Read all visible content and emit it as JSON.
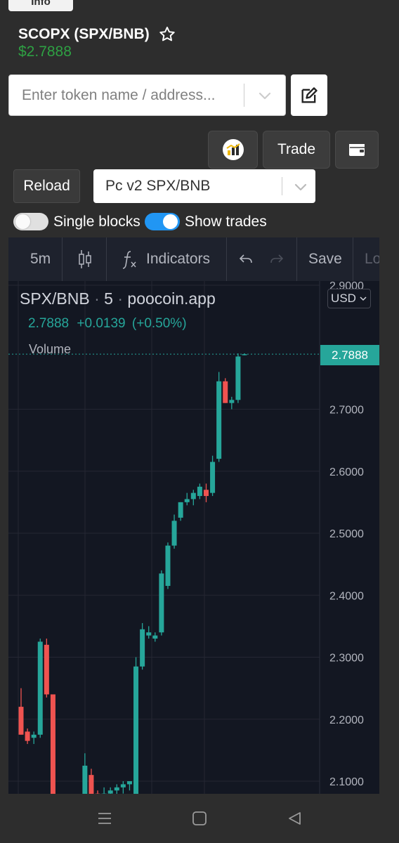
{
  "header": {
    "info_tab": "Info",
    "title": "SCOPX (SPX/BNB)",
    "price": "$2.7888"
  },
  "search": {
    "placeholder": "Enter token name / address..."
  },
  "toolbar": {
    "trade_label": "Trade"
  },
  "controls": {
    "reload_label": "Reload",
    "pair_select_value": "Pc v2 SPX/BNB",
    "single_blocks_label": "Single blocks",
    "single_blocks_on": false,
    "show_trades_label": "Show trades",
    "show_trades_on": true
  },
  "chart_toolbar": {
    "interval": "5m",
    "indicators_label": "Indicators",
    "save_label": "Save",
    "cut_label": "Lo"
  },
  "chart_legend": {
    "symbol": "SPX/BNB",
    "interval": "5",
    "source": "poocoin.app",
    "last": "2.7888",
    "change": "+0.0139",
    "change_pct": "(+0.50%)",
    "volume_label": "Volume",
    "currency": "USD"
  },
  "colors": {
    "up": "#26a69a",
    "down": "#ef5350",
    "price_green": "#2ea043",
    "toggle_on": "#2196f3"
  },
  "chart_data": {
    "type": "candlestick",
    "symbol": "SPX/BNB",
    "interval": "5",
    "ylim": [
      2.07,
      2.905
    ],
    "y_ticks": [
      "2.9000",
      "2.7000",
      "2.6000",
      "2.5000",
      "2.4000",
      "2.3000",
      "2.2000",
      "2.1000"
    ],
    "last_price_label": "2.7888",
    "candles": [
      {
        "o": 2.22,
        "h": 2.25,
        "l": 2.175,
        "c": 2.175
      },
      {
        "o": 2.18,
        "h": 2.185,
        "l": 2.16,
        "c": 2.165
      },
      {
        "o": 2.17,
        "h": 2.18,
        "l": 2.16,
        "c": 2.175
      },
      {
        "o": 2.175,
        "h": 2.33,
        "l": 2.17,
        "c": 2.325
      },
      {
        "o": 2.32,
        "h": 2.33,
        "l": 2.235,
        "c": 2.24
      },
      {
        "o": 2.24,
        "h": 2.24,
        "l": 2.04,
        "c": 2.05
      },
      {
        "o": 2.05,
        "h": 2.05,
        "l": 2.03,
        "c": 2.035
      },
      {
        "o": 2.035,
        "h": 2.045,
        "l": 2.03,
        "c": 2.04
      },
      {
        "o": 2.045,
        "h": 2.05,
        "l": 2.035,
        "c": 2.04
      },
      {
        "o": 2.04,
        "h": 2.06,
        "l": 2.035,
        "c": 2.055
      },
      {
        "o": 2.055,
        "h": 2.145,
        "l": 2.05,
        "c": 2.125
      },
      {
        "o": 2.11,
        "h": 2.12,
        "l": 2.07,
        "c": 2.075
      },
      {
        "o": 2.08,
        "h": 2.085,
        "l": 2.07,
        "c": 2.075
      },
      {
        "o": 2.08,
        "h": 2.09,
        "l": 2.07,
        "c": 2.08
      },
      {
        "o": 2.08,
        "h": 2.09,
        "l": 2.07,
        "c": 2.085
      },
      {
        "o": 2.085,
        "h": 2.095,
        "l": 2.075,
        "c": 2.09
      },
      {
        "o": 2.09,
        "h": 2.1,
        "l": 2.08,
        "c": 2.095
      },
      {
        "o": 2.095,
        "h": 2.1,
        "l": 2.085,
        "c": 2.1
      },
      {
        "o": 2.07,
        "h": 2.3,
        "l": 2.06,
        "c": 2.285
      },
      {
        "o": 2.285,
        "h": 2.355,
        "l": 2.28,
        "c": 2.345
      },
      {
        "o": 2.335,
        "h": 2.35,
        "l": 2.33,
        "c": 2.34
      },
      {
        "o": 2.33,
        "h": 2.34,
        "l": 2.325,
        "c": 2.335
      },
      {
        "o": 2.34,
        "h": 2.44,
        "l": 2.335,
        "c": 2.435
      },
      {
        "o": 2.415,
        "h": 2.485,
        "l": 2.41,
        "c": 2.48
      },
      {
        "o": 2.48,
        "h": 2.53,
        "l": 2.475,
        "c": 2.52
      },
      {
        "o": 2.525,
        "h": 2.55,
        "l": 2.52,
        "c": 2.55
      },
      {
        "o": 2.55,
        "h": 2.565,
        "l": 2.545,
        "c": 2.555
      },
      {
        "o": 2.555,
        "h": 2.57,
        "l": 2.545,
        "c": 2.565
      },
      {
        "o": 2.56,
        "h": 2.58,
        "l": 2.555,
        "c": 2.575
      },
      {
        "o": 2.57,
        "h": 2.58,
        "l": 2.55,
        "c": 2.56
      },
      {
        "o": 2.565,
        "h": 2.625,
        "l": 2.56,
        "c": 2.615
      },
      {
        "o": 2.62,
        "h": 2.76,
        "l": 2.615,
        "c": 2.745
      },
      {
        "o": 2.745,
        "h": 2.75,
        "l": 2.71,
        "c": 2.71
      },
      {
        "o": 2.71,
        "h": 2.72,
        "l": 2.7,
        "c": 2.715
      },
      {
        "o": 2.715,
        "h": 2.79,
        "l": 2.71,
        "c": 2.785
      },
      {
        "o": 2.788,
        "h": 2.79,
        "l": 2.787,
        "c": 2.7888
      }
    ]
  }
}
